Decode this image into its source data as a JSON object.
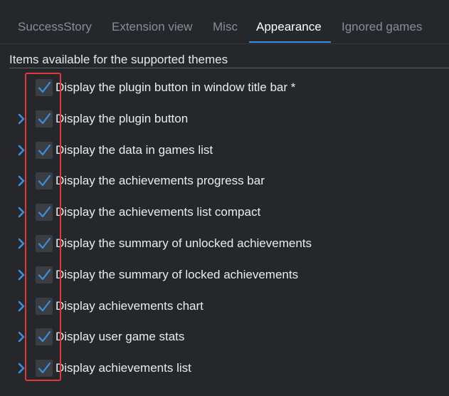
{
  "tabs": [
    {
      "label": "SuccessStory",
      "active": false
    },
    {
      "label": "Extension view",
      "active": false
    },
    {
      "label": "Misc",
      "active": false
    },
    {
      "label": "Appearance",
      "active": true
    },
    {
      "label": "Ignored games",
      "active": false
    }
  ],
  "section": {
    "title": "Items available for the supported themes"
  },
  "items": [
    {
      "label": "Display the plugin button in window title bar *",
      "checked": true,
      "has_expander": false
    },
    {
      "label": "Display the plugin button",
      "checked": true,
      "has_expander": true
    },
    {
      "label": "Display the data in games list",
      "checked": true,
      "has_expander": true
    },
    {
      "label": "Display the achievements progress bar",
      "checked": true,
      "has_expander": true
    },
    {
      "label": "Display the achievements list compact",
      "checked": true,
      "has_expander": true
    },
    {
      "label": "Display the summary of unlocked achievements",
      "checked": true,
      "has_expander": true
    },
    {
      "label": "Display the summary of locked achievements",
      "checked": true,
      "has_expander": true
    },
    {
      "label": "Display achievements chart",
      "checked": true,
      "has_expander": true
    },
    {
      "label": "Display user game stats",
      "checked": true,
      "has_expander": true
    },
    {
      "label": "Display achievements list",
      "checked": true,
      "has_expander": true
    }
  ],
  "colors": {
    "background": "#25272b",
    "accent": "#3b8fe0",
    "checkbox_bg": "#3a3d42",
    "highlight_border": "#e0383b"
  },
  "icons": {
    "checkmark": "checkmark-icon",
    "expander": "chevron-right-icon"
  }
}
